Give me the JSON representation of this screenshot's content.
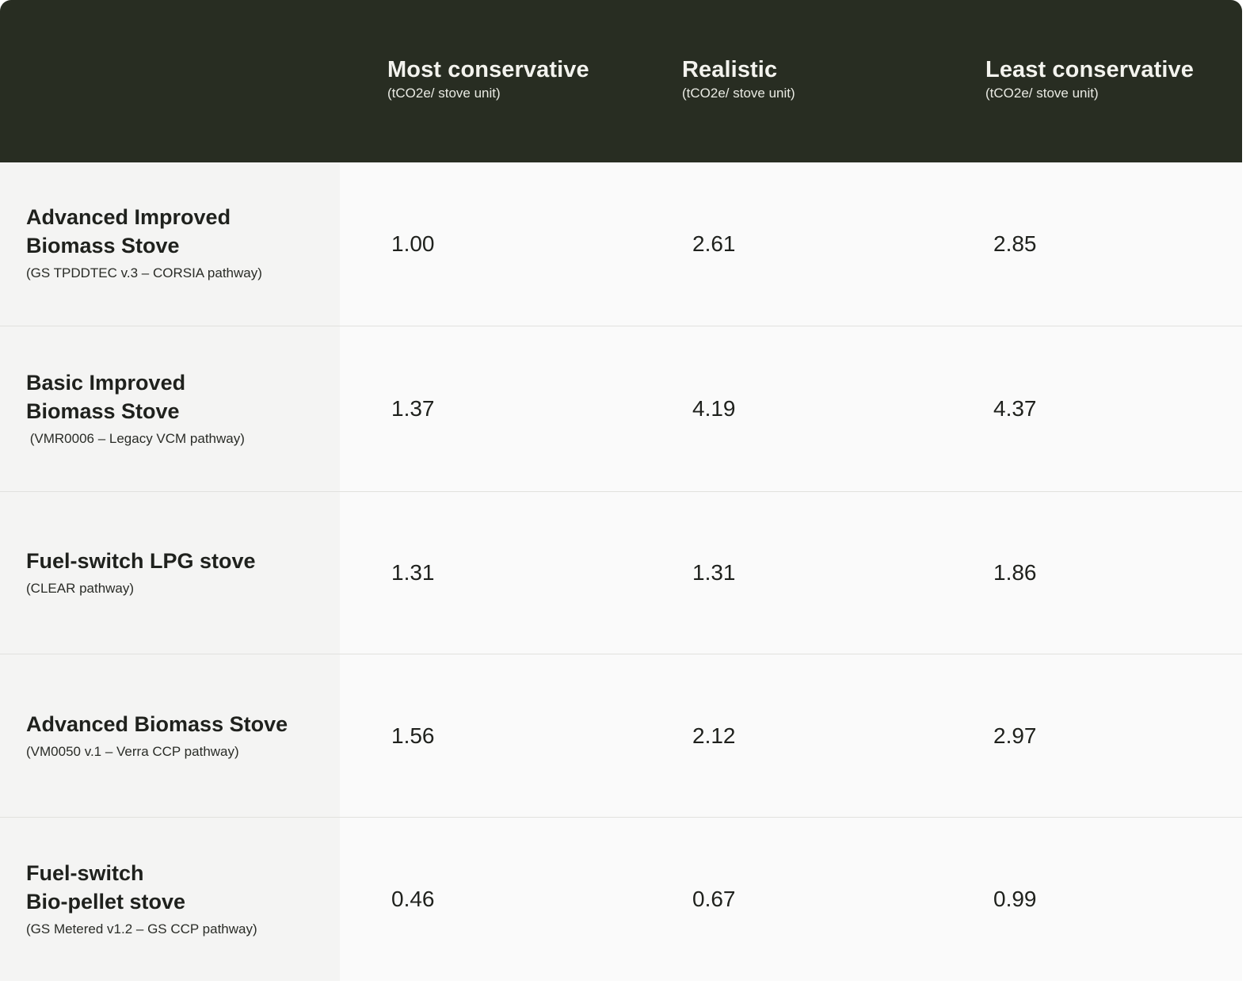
{
  "header": {
    "columns": [
      {
        "title": "Most conservative",
        "unit": "(tCO2e/ stove unit)"
      },
      {
        "title": "Realistic",
        "unit": "(tCO2e/ stove unit)"
      },
      {
        "title": "Least conservative",
        "unit": "(tCO2e/ stove unit)"
      }
    ]
  },
  "rows": [
    {
      "name": "Advanced Improved\nBiomass Stove",
      "subtitle": "(GS TPDDTEC v.3 – CORSIA pathway)",
      "values": [
        "1.00",
        "2.61",
        "2.85"
      ]
    },
    {
      "name": "Basic Improved\nBiomass Stove",
      "subtitle": " (VMR0006 – Legacy VCM pathway)",
      "values": [
        "1.37",
        "4.19",
        "4.37"
      ]
    },
    {
      "name": "Fuel-switch LPG stove",
      "subtitle": "(CLEAR pathway)",
      "values": [
        "1.31",
        "1.31",
        "1.86"
      ]
    },
    {
      "name": "Advanced Biomass Stove",
      "subtitle": "(VM0050 v.1 – Verra CCP pathway)",
      "values": [
        "1.56",
        "2.12",
        "2.97"
      ]
    },
    {
      "name": "Fuel-switch\nBio-pellet stove",
      "subtitle": "(GS Metered v1.2 – GS CCP pathway)",
      "values": [
        "0.46",
        "0.67",
        "0.99"
      ]
    }
  ],
  "colors": {
    "header_bg": "#282d22",
    "header_text": "#f3f3ee",
    "label_bg": "#f4f4f3",
    "body_bg": "#fafafa",
    "divider": "#e1e1de"
  }
}
